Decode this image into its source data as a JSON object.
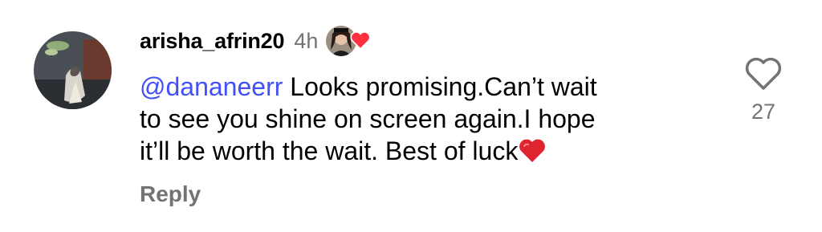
{
  "comment": {
    "username": "arisha_afrin20",
    "time": "4h",
    "mention": "@dananeerr",
    "text_line1": " Looks promising.Can’t wait",
    "text_line2": "to see you shine on screen again.I hope",
    "text_line3": "it’ll be worth the wait. Best of luck",
    "reply_label": "Reply",
    "like_count": "27",
    "icons": {
      "avatar": "avatar",
      "liked_by": "author-liked-heart-icon",
      "emoji": "red-heart-emoji-icon",
      "like": "heart-outline-icon"
    },
    "colors": {
      "mention": "#4150f7",
      "muted": "#737373",
      "heart": "#ff3040"
    }
  }
}
